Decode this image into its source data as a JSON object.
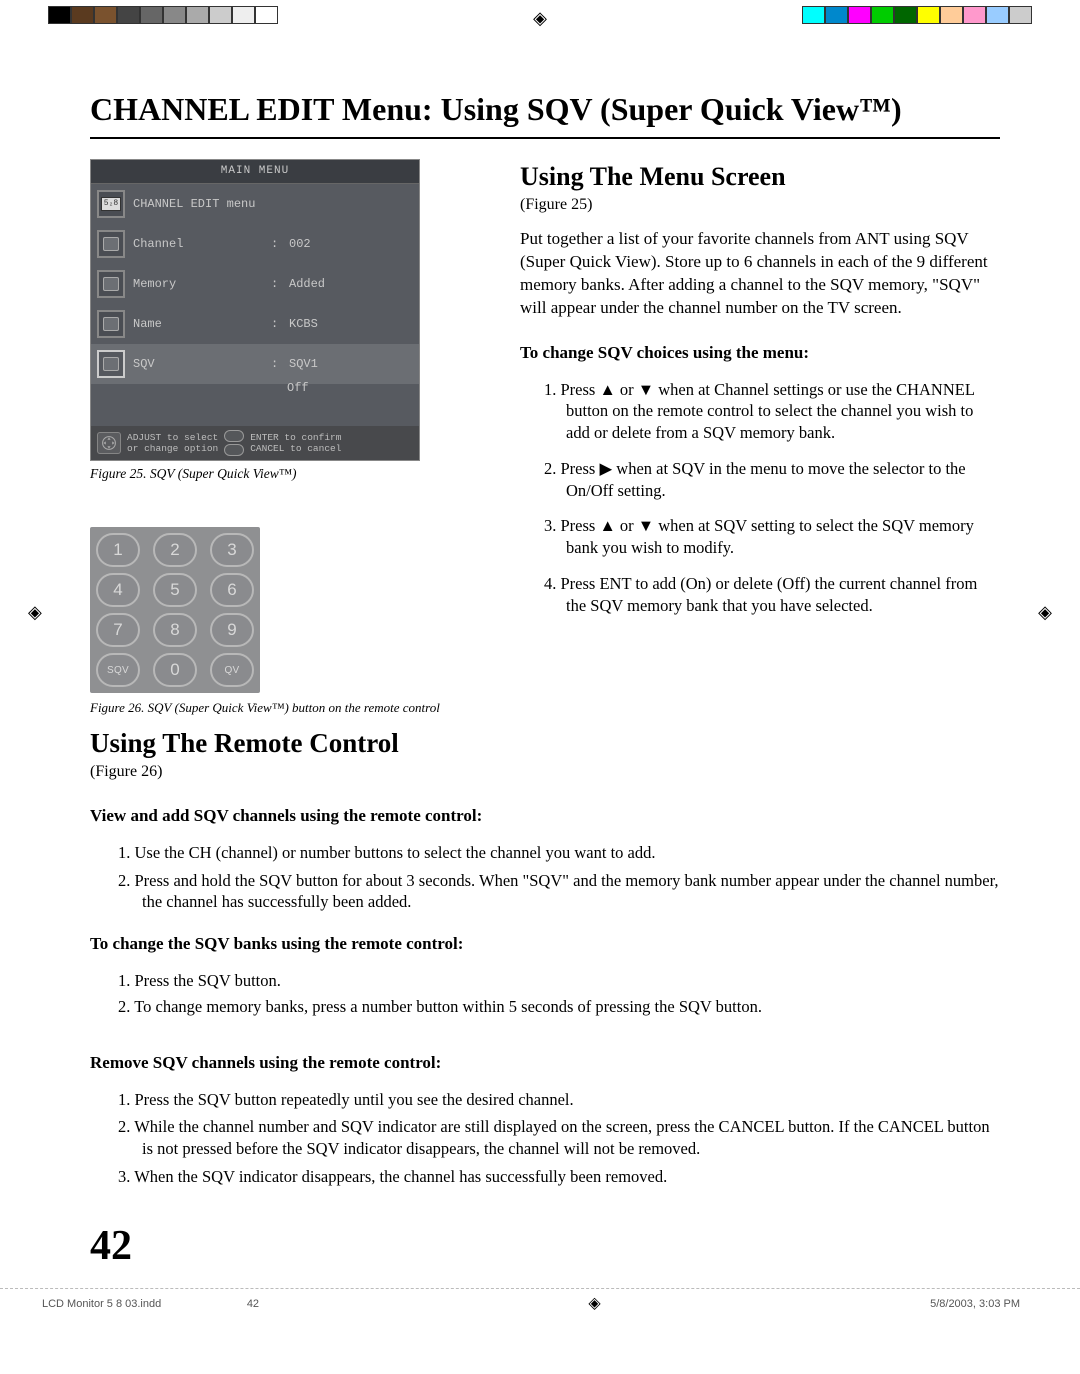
{
  "title": "CHANNEL EDIT Menu: Using SQV (Super Quick View™)",
  "menu": {
    "header": "MAIN MENU",
    "section": "CHANNEL EDIT menu",
    "rows": [
      {
        "label": "Channel",
        "value": "002"
      },
      {
        "label": "Memory",
        "value": "Added"
      },
      {
        "label": "Name",
        "value": "KCBS"
      },
      {
        "label": "SQV",
        "value": "SQV1",
        "value2": "Off"
      }
    ],
    "footer": {
      "l1a": "ADJUST to select",
      "l1b": "or change option",
      "r1a": "ENTER to confirm",
      "r1b": "CANCEL to cancel"
    }
  },
  "fig25": "Figure 25. SQV (Super Quick View™)",
  "keypad": {
    "rows": [
      [
        "1",
        "2",
        "3"
      ],
      [
        "4",
        "5",
        "6"
      ],
      [
        "7",
        "8",
        "9"
      ],
      [
        "SQV",
        "0",
        "QV"
      ]
    ]
  },
  "fig26": "Figure 26. SQV (Super Quick View™) button on the remote control",
  "right": {
    "h": "Using The Menu Screen",
    "figref": "(Figure 25)",
    "para": "Put together a list of your favorite channels from ANT using SQV (Super Quick View).  Store up to 6 channels in each of the 9 different memory banks.  After adding a channel to the SQV memory, \"SQV\" will appear under the channel number on the TV screen.",
    "sub": "To change SQV choices using the menu:",
    "steps": [
      "1.  Press  ▲ or  ▼ when at Channel settings or use the CHANNEL button on the remote control to select the channel you wish to add or delete from a SQV memory bank.",
      "2. Press  ▶ when at SQV in the menu to move the selector to the On/Off setting.",
      "3.  Press  ▲ or  ▼ when at SQV setting to select the SQV memory bank you wish to modify.",
      "4.  Press ENT to add (On) or delete (Off) the current channel from the SQV memory bank that you have selected."
    ]
  },
  "below": {
    "h": "Using The Remote Control",
    "figref": "(Figure 26)",
    "sub1": "View and add SQV channels using the remote control:",
    "list1": [
      "1. Use the CH (channel) or number buttons to select the channel you want to add.",
      "2. Press and hold the SQV button for about 3 seconds.  When \"SQV\" and the memory bank number appear under the channel number, the channel has successfully been added."
    ],
    "sub2": "To change the SQV banks using the remote control:",
    "list2": [
      "1.  Press the SQV button.",
      "2. To change memory banks, press a number button within 5 seconds of pressing the SQV button."
    ],
    "sub3": "Remove SQV channels using the remote control:",
    "list3": [
      "1. Press the SQV button repeatedly until you see the desired channel.",
      "2. While the channel number and SQV indicator are still displayed on the screen, press the CANCEL button.  If the CANCEL button is not pressed before the SQV indicator disappears, the channel will not be removed.",
      "3. When the SQV indicator disappears, the channel has successfully been removed."
    ]
  },
  "pagenum": "42",
  "slug": {
    "file": "LCD Monitor 5 8 03.indd",
    "pg": "42",
    "ts": "5/8/2003, 3:03 PM"
  }
}
